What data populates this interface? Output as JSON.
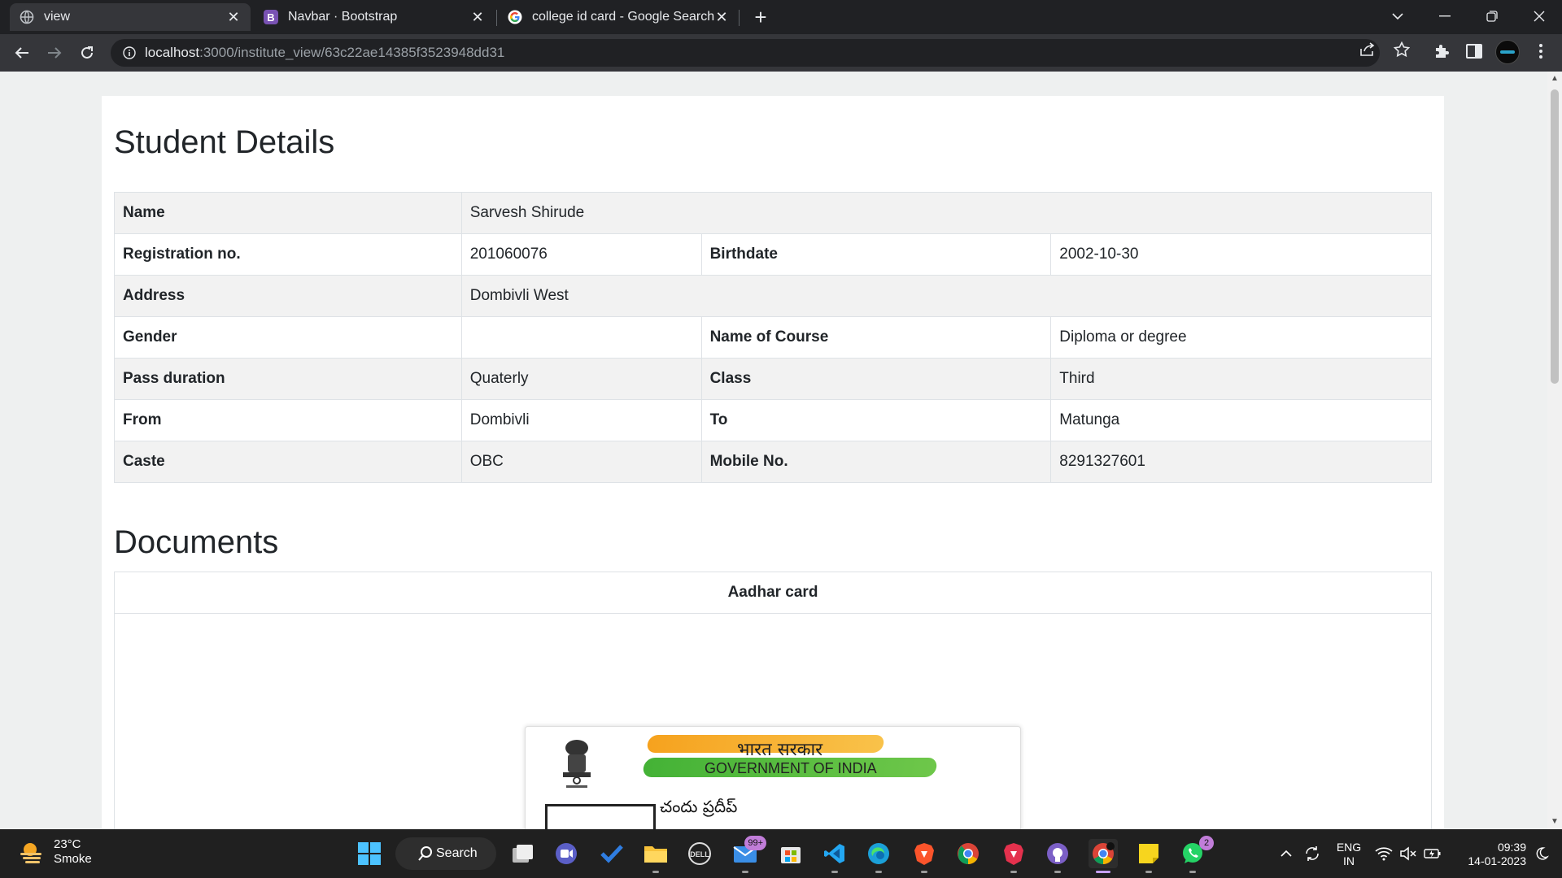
{
  "browser": {
    "tabs": [
      {
        "title": "view",
        "icon": "globe-icon"
      },
      {
        "title": "Navbar · Bootstrap",
        "icon": "bootstrap-icon"
      },
      {
        "title": "college id card - Google Search",
        "icon": "google-icon"
      }
    ],
    "active_tab": 0,
    "url_host": "localhost",
    "url_path": ":3000/institute_view/63c22ae14385f3523948dd31"
  },
  "page": {
    "title": "Student Details",
    "rows": [
      {
        "k1": "Name",
        "v1": "Sarvesh Shirude"
      },
      {
        "k1": "Registration no.",
        "v1": "201060076",
        "k2": "Birthdate",
        "v2": "2002-10-30"
      },
      {
        "k1": "Address",
        "v1": "Dombivli West"
      },
      {
        "k1": "Gender",
        "v1": "",
        "k2": "Name of Course",
        "v2": "Diploma or degree"
      },
      {
        "k1": "Pass duration",
        "v1": "Quaterly",
        "k2": "Class",
        "v2": "Third"
      },
      {
        "k1": "From",
        "v1": "Dombivli",
        "k2": "To",
        "v2": "Matunga"
      },
      {
        "k1": "Caste",
        "v1": "OBC",
        "k2": "Mobile No.",
        "v2": "8291327601"
      }
    ],
    "documents_title": "Documents",
    "documents_header": "Aadhar card",
    "aadhar": {
      "gov_hindi": "भारत सरकार",
      "gov_english": "GOVERNMENT OF INDIA",
      "name_telugu": "చందు ప్రదీప్"
    }
  },
  "taskbar": {
    "weather_temp": "23°C",
    "weather_desc": "Smoke",
    "search_label": "Search",
    "mail_badge": "99+",
    "whatsapp_badge": "2",
    "lang_line1": "ENG",
    "lang_line2": "IN",
    "time": "09:39",
    "date": "14-01-2023"
  }
}
